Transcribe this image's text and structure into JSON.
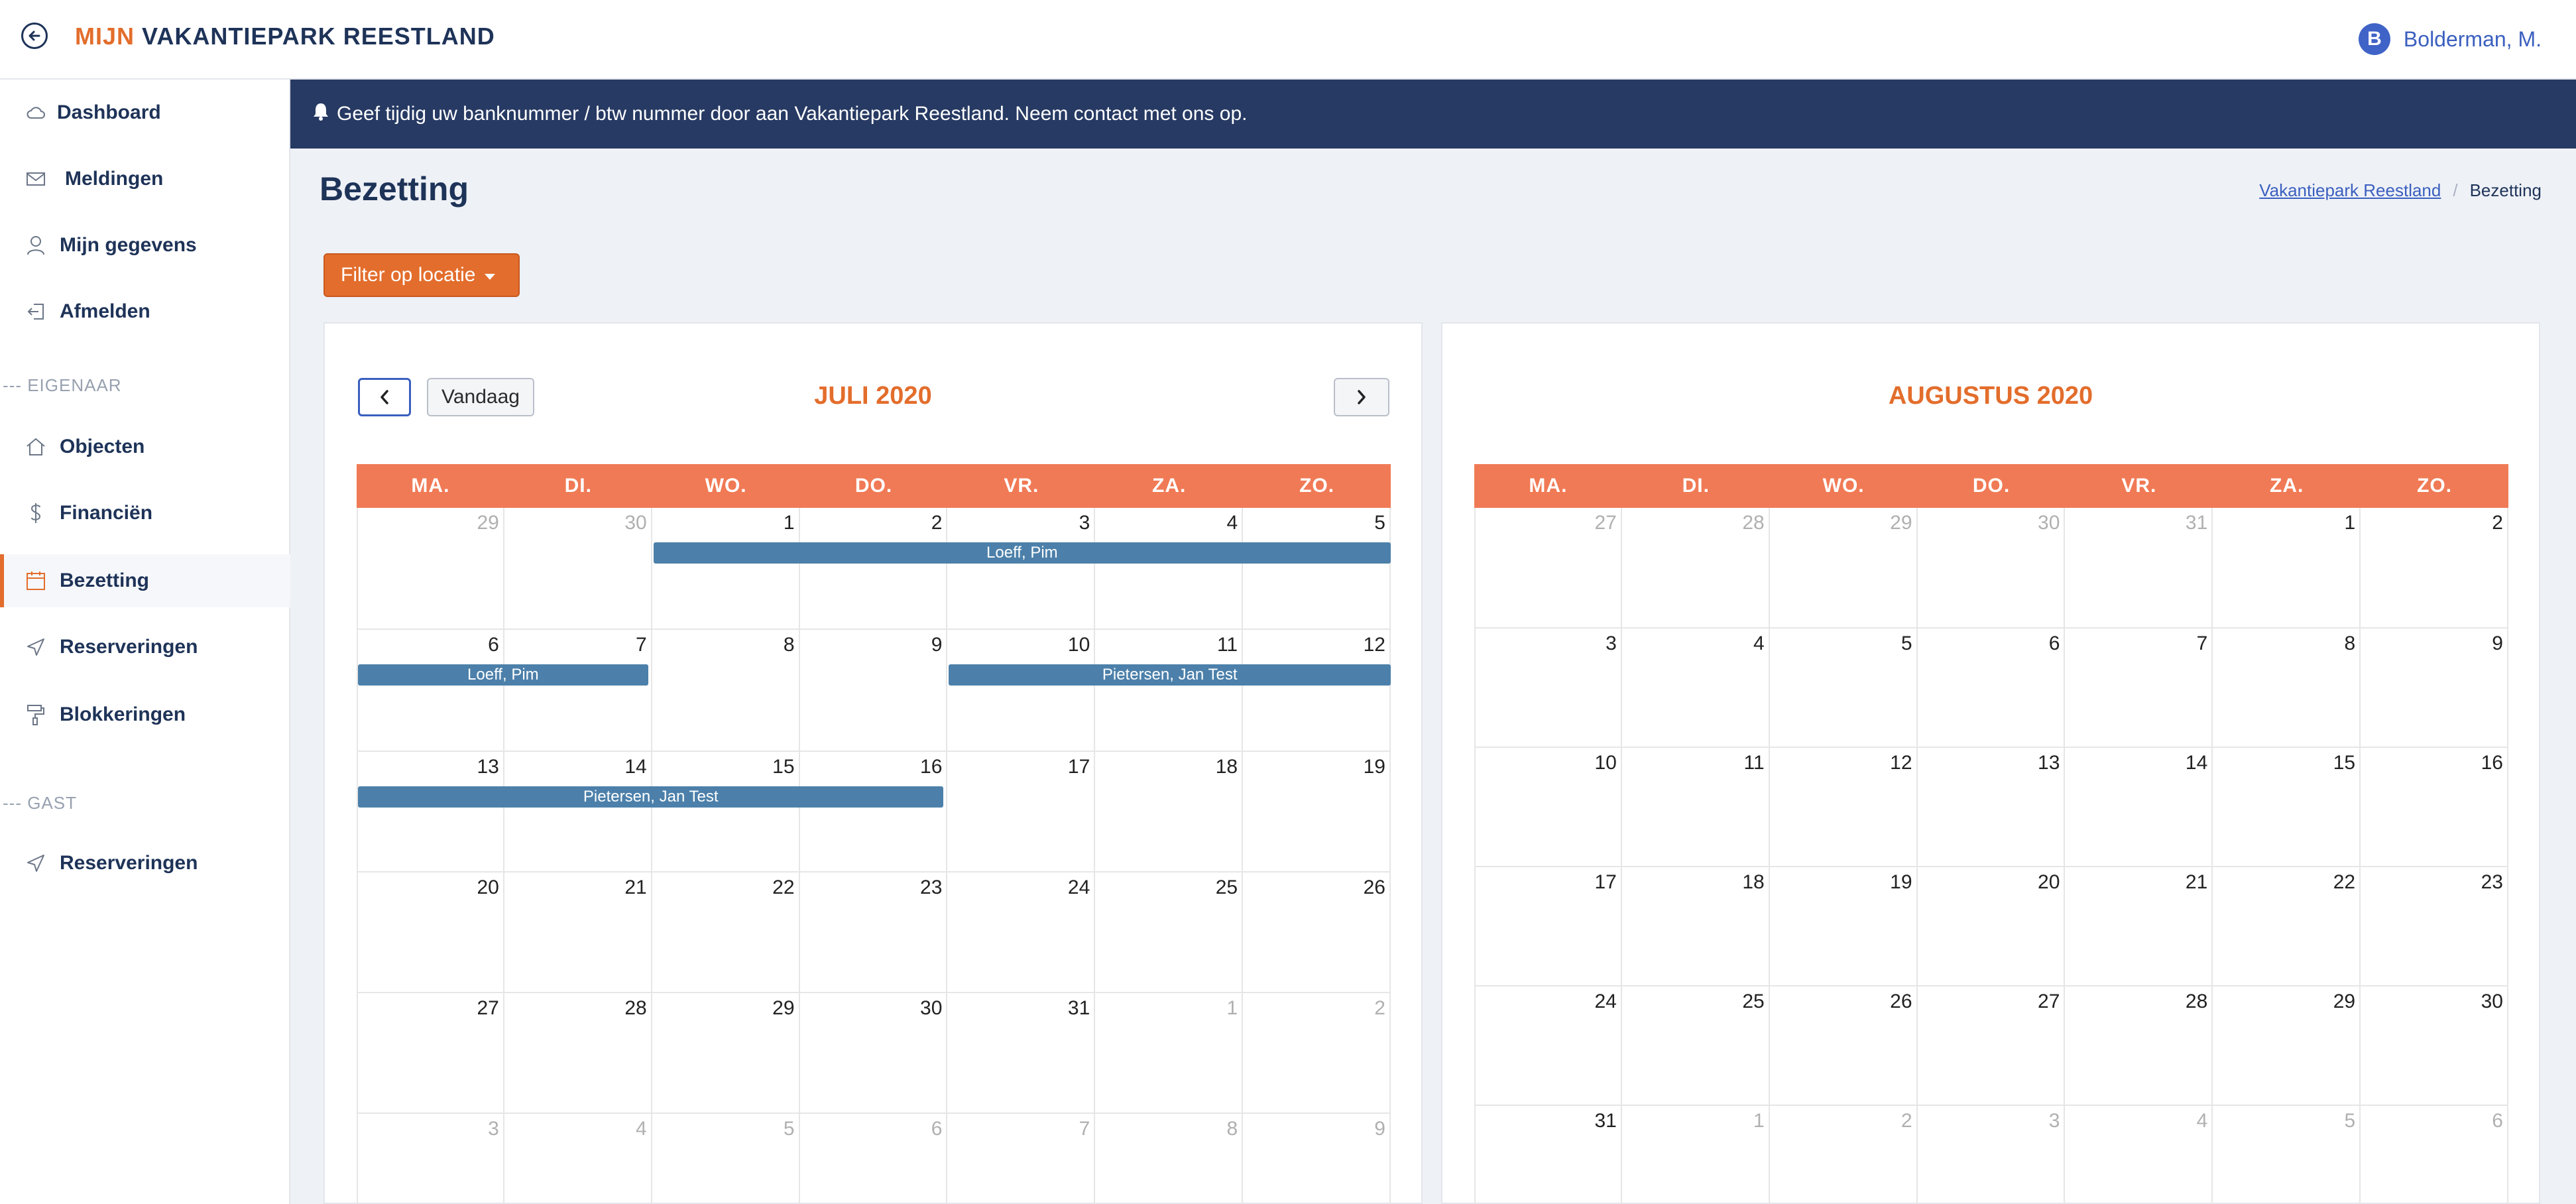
{
  "header": {
    "brand_prefix": "MIJN",
    "brand_name": "VAKANTIEPARK REESTLAND",
    "user_initial": "B",
    "user_name": "Bolderman, M."
  },
  "sidebar": {
    "items": [
      {
        "label": "Dashboard",
        "icon": "cloud-icon"
      },
      {
        "label": "Meldingen",
        "icon": "envelope-icon"
      },
      {
        "label": "Mijn gegevens",
        "icon": "user-icon"
      },
      {
        "label": "Afmelden",
        "icon": "logout-icon"
      }
    ],
    "owner_section": "--- EIGENAAR",
    "owner_items": [
      {
        "label": "Objecten",
        "icon": "home-icon"
      },
      {
        "label": "Financiën",
        "icon": "dollar-icon"
      },
      {
        "label": "Bezetting",
        "icon": "calendar-icon",
        "active": true
      },
      {
        "label": "Reserveringen",
        "icon": "send-icon"
      },
      {
        "label": "Blokkeringen",
        "icon": "paint-roller-icon"
      }
    ],
    "guest_section": "--- GAST",
    "guest_items": [
      {
        "label": "Reserveringen",
        "icon": "send-icon"
      }
    ]
  },
  "notice": {
    "text": "Geef tijdig uw banknummer / btw nummer door aan Vakantiepark Reestland. Neem contact met ons op.",
    "icon": "bell-icon"
  },
  "page": {
    "title": "Bezetting",
    "breadcrumb_link": "Vakantiepark Reestland",
    "breadcrumb_current": "Bezetting",
    "filter_label": "Filter op locatie"
  },
  "calendars": [
    {
      "title": "JULI 2020",
      "today_label": "Vandaag",
      "weekdays": [
        "MA.",
        "DI.",
        "WO.",
        "DO.",
        "VR.",
        "ZA.",
        "ZO."
      ],
      "weeks": [
        [
          {
            "d": "29",
            "o": true
          },
          {
            "d": "30",
            "o": true
          },
          {
            "d": "1"
          },
          {
            "d": "2"
          },
          {
            "d": "3"
          },
          {
            "d": "4"
          },
          {
            "d": "5"
          }
        ],
        [
          {
            "d": "6"
          },
          {
            "d": "7"
          },
          {
            "d": "8"
          },
          {
            "d": "9"
          },
          {
            "d": "10"
          },
          {
            "d": "11"
          },
          {
            "d": "12"
          }
        ],
        [
          {
            "d": "13"
          },
          {
            "d": "14"
          },
          {
            "d": "15"
          },
          {
            "d": "16"
          },
          {
            "d": "17"
          },
          {
            "d": "18"
          },
          {
            "d": "19"
          }
        ],
        [
          {
            "d": "20"
          },
          {
            "d": "21"
          },
          {
            "d": "22"
          },
          {
            "d": "23"
          },
          {
            "d": "24"
          },
          {
            "d": "25"
          },
          {
            "d": "26"
          }
        ],
        [
          {
            "d": "27"
          },
          {
            "d": "28"
          },
          {
            "d": "29"
          },
          {
            "d": "30"
          },
          {
            "d": "31"
          },
          {
            "d": "1",
            "o": true
          },
          {
            "d": "2",
            "o": true
          }
        ],
        [
          {
            "d": "3",
            "o": true
          },
          {
            "d": "4",
            "o": true
          },
          {
            "d": "5",
            "o": true
          },
          {
            "d": "6",
            "o": true
          },
          {
            "d": "7",
            "o": true
          },
          {
            "d": "8",
            "o": true
          },
          {
            "d": "9",
            "o": true
          }
        ]
      ],
      "events": [
        {
          "label": "Loeff, Pim",
          "week": 0,
          "start": 2,
          "end": 6
        },
        {
          "label": "Loeff, Pim",
          "week": 1,
          "start": 0,
          "end": 1
        },
        {
          "label": "Pietersen, Jan Test",
          "week": 1,
          "start": 4,
          "end": 6
        },
        {
          "label": "Pietersen, Jan Test",
          "week": 2,
          "start": 0,
          "end": 3
        }
      ]
    },
    {
      "title": "AUGUSTUS 2020",
      "weekdays": [
        "MA.",
        "DI.",
        "WO.",
        "DO.",
        "VR.",
        "ZA.",
        "ZO."
      ],
      "weeks": [
        [
          {
            "d": "27",
            "o": true
          },
          {
            "d": "28",
            "o": true
          },
          {
            "d": "29",
            "o": true
          },
          {
            "d": "30",
            "o": true
          },
          {
            "d": "31",
            "o": true
          },
          {
            "d": "1"
          },
          {
            "d": "2"
          }
        ],
        [
          {
            "d": "3"
          },
          {
            "d": "4"
          },
          {
            "d": "5"
          },
          {
            "d": "6"
          },
          {
            "d": "7"
          },
          {
            "d": "8"
          },
          {
            "d": "9"
          }
        ],
        [
          {
            "d": "10"
          },
          {
            "d": "11"
          },
          {
            "d": "12"
          },
          {
            "d": "13"
          },
          {
            "d": "14"
          },
          {
            "d": "15"
          },
          {
            "d": "16"
          }
        ],
        [
          {
            "d": "17"
          },
          {
            "d": "18"
          },
          {
            "d": "19"
          },
          {
            "d": "20"
          },
          {
            "d": "21"
          },
          {
            "d": "22"
          },
          {
            "d": "23"
          }
        ],
        [
          {
            "d": "24"
          },
          {
            "d": "25"
          },
          {
            "d": "26"
          },
          {
            "d": "27"
          },
          {
            "d": "28"
          },
          {
            "d": "29"
          },
          {
            "d": "30"
          }
        ],
        [
          {
            "d": "31"
          },
          {
            "d": "1",
            "o": true
          },
          {
            "d": "2",
            "o": true
          },
          {
            "d": "3",
            "o": true
          },
          {
            "d": "4",
            "o": true
          },
          {
            "d": "5",
            "o": true
          },
          {
            "d": "6",
            "o": true
          }
        ]
      ],
      "events": []
    }
  ],
  "colors": {
    "accent": "#e36d2c",
    "navy": "#1e3358",
    "event": "#4c80aa",
    "weekday_header": "#f07a55"
  }
}
